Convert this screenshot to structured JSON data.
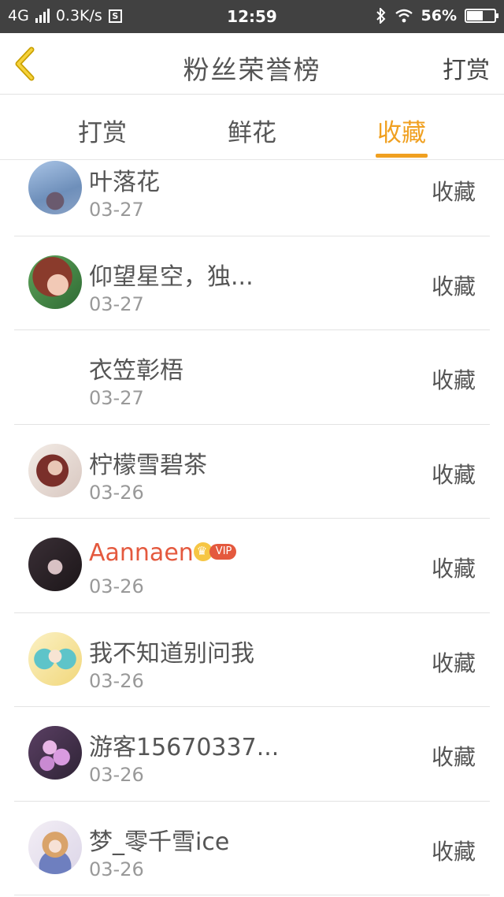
{
  "status_bar": {
    "network": "4G",
    "speed": "0.3K/s",
    "s_icon": "S",
    "time": "12:59",
    "battery": "56%"
  },
  "nav": {
    "back_icon": "chevron-left-icon",
    "title": "粉丝荣誉榜",
    "action": "打赏"
  },
  "tabs": [
    {
      "label": "打赏",
      "active": false
    },
    {
      "label": "鲜花",
      "active": false
    },
    {
      "label": "收藏",
      "active": true
    }
  ],
  "colors": {
    "accent": "#f0a020",
    "vip_name": "#e4593e",
    "status_bar": "#414141"
  },
  "items": [
    {
      "name": "叶落花",
      "date": "03-27",
      "action": "收藏"
    },
    {
      "name": "仰望星空，独...",
      "date": "03-27",
      "action": "收藏"
    },
    {
      "name": "衣笠彰梧",
      "date": "03-27",
      "action": "收藏"
    },
    {
      "name": "柠檬雪碧茶",
      "date": "03-26",
      "action": "收藏"
    },
    {
      "name": "Aannaen",
      "vip_label": "VIP",
      "date": "03-26",
      "action": "收藏"
    },
    {
      "name": "我不知道别问我",
      "date": "03-26",
      "action": "收藏"
    },
    {
      "name": "游客15670337...",
      "date": "03-26",
      "action": "收藏"
    },
    {
      "name": "梦_零千雪ice",
      "date": "03-26",
      "action": "收藏"
    }
  ]
}
